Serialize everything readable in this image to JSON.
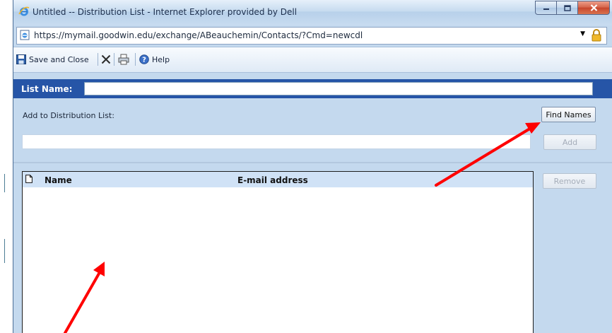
{
  "window": {
    "title": "Untitled -- Distribution List - Internet Explorer provided by Dell",
    "url": "https://mymail.goodwin.edu/exchange/ABeauchemin/Contacts/?Cmd=newcdl",
    "icons": [
      "ie-logo-icon",
      "minimize-icon",
      "maximize-icon",
      "close-icon",
      "lock-icon"
    ]
  },
  "toolbar": {
    "save_close_label": "Save and Close",
    "help_label": "Help",
    "icons": [
      "save-icon",
      "delete-icon",
      "print-icon",
      "help-icon"
    ]
  },
  "form": {
    "list_name_label": "List Name:",
    "list_name_value": "",
    "add_to_label": "Add to Distribution List:",
    "find_names_label": "Find Names",
    "add_label": "Add",
    "remove_label": "Remove",
    "recipient_value": ""
  },
  "grid": {
    "columns": [
      "Name",
      "E-mail address"
    ],
    "rows": []
  },
  "colors": {
    "window_bg": "#c4d9ee",
    "header_bar": "#2655a7",
    "annotation_arrow": "#ff0000"
  }
}
